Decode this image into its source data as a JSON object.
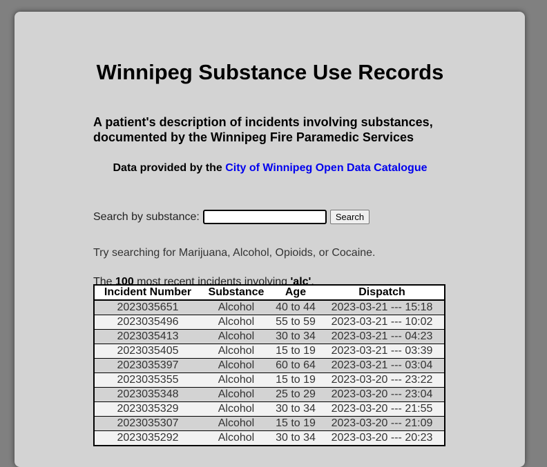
{
  "page": {
    "title": "Winnipeg Substance Use Records",
    "subtitle": "A patient's description of incidents involving substances, documented by the Winnipeg Fire Paramedic Services",
    "credit_prefix": "Data provided by the ",
    "credit_link": "City of Winnipeg Open Data Catalogue"
  },
  "search": {
    "label": "Search by substance:",
    "value": "",
    "button": "Search",
    "hint": "Try searching for Marijuana, Alcohol, Opioids, or Cocaine."
  },
  "summary": {
    "prefix": "The ",
    "count": "100",
    "middle": " most recent incidents involving ",
    "query": "'alc'",
    "suffix": "."
  },
  "table": {
    "headers": [
      "Incident Number",
      "Substance",
      "Age",
      "Dispatch"
    ],
    "rows": [
      [
        "2023035651",
        "Alcohol",
        "40 to 44",
        "2023-03-21 --- 15:18"
      ],
      [
        "2023035496",
        "Alcohol",
        "55 to 59",
        "2023-03-21 --- 10:02"
      ],
      [
        "2023035413",
        "Alcohol",
        "30 to 34",
        "2023-03-21 --- 04:23"
      ],
      [
        "2023035405",
        "Alcohol",
        "15 to 19",
        "2023-03-21 --- 03:39"
      ],
      [
        "2023035397",
        "Alcohol",
        "60 to 64",
        "2023-03-21 --- 03:04"
      ],
      [
        "2023035355",
        "Alcohol",
        "15 to 19",
        "2023-03-20 --- 23:22"
      ],
      [
        "2023035348",
        "Alcohol",
        "25 to 29",
        "2023-03-20 --- 23:04"
      ],
      [
        "2023035329",
        "Alcohol",
        "30 to 34",
        "2023-03-20 --- 21:55"
      ],
      [
        "2023035307",
        "Alcohol",
        "15 to 19",
        "2023-03-20 --- 21:09"
      ],
      [
        "2023035292",
        "Alcohol",
        "30 to 34",
        "2023-03-20 --- 20:23"
      ]
    ]
  },
  "colors": {
    "background": "#808080",
    "panel": "#d3d3d3",
    "link": "#0000ee",
    "row_alt": "#f2f2f2"
  }
}
